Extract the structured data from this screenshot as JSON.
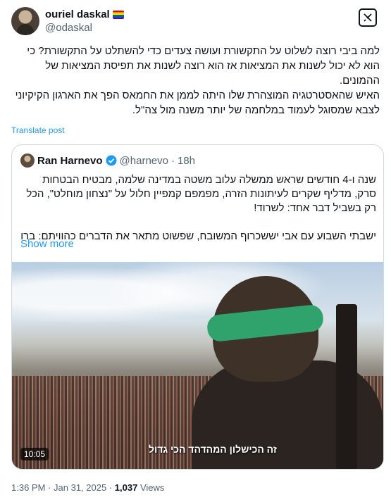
{
  "author": {
    "name": "ouriel daskal",
    "handle": "@odaskal"
  },
  "tweet": {
    "paragraphs": [
      "למה ביבי רוצה לשלוט על התקשורת ועושה צעדים כדי להשתלט על התקשורת? כי הוא לא יכול לשנות את המציאות אז הוא רוצה לשנות את תפיסת המציאות של ההמונים.",
      "האיש שהאסטרטגיה המוצהרת שלו היתה לממן את החמאס הפך את הארגון הקיקיוני לצבא שמסוגל לעמוד במלחמה של יותר משנה מול צה\"ל."
    ],
    "translate_label": "Translate post"
  },
  "quote": {
    "name": "Ran Harnevo",
    "handle": "@harnevo",
    "separator": "·",
    "time": "18h",
    "para1": "שנה ו-4 חודשים שראש ממשלה עלוב משטה במדינה שלמה, מבטיח הבטחות סרק, מדליף שקרים לעיתונות הזרה, מפמפם קמפיין חלול על \"נצחון מוחלט\", הכל רק בשביל דבר אחד: לשרוד!",
    "para2": "ישבתי השבוע עם אבי יששכרוף המשובח, שפשוט מתאר את הדברים כהוויתם: ברוכי...",
    "show_more": "Show more",
    "video": {
      "caption": "זה הכישלון המהדהד הכי גדול",
      "duration": "10:05"
    }
  },
  "footer": {
    "time": "1:36 PM",
    "separator": "·",
    "date": "Jan 31, 2025",
    "views_count": "1,037",
    "views_label": "Views"
  },
  "colors": {
    "accent": "#1d9bf0",
    "muted": "#536471",
    "text": "#0f1419",
    "headband": "#2fa36b"
  }
}
